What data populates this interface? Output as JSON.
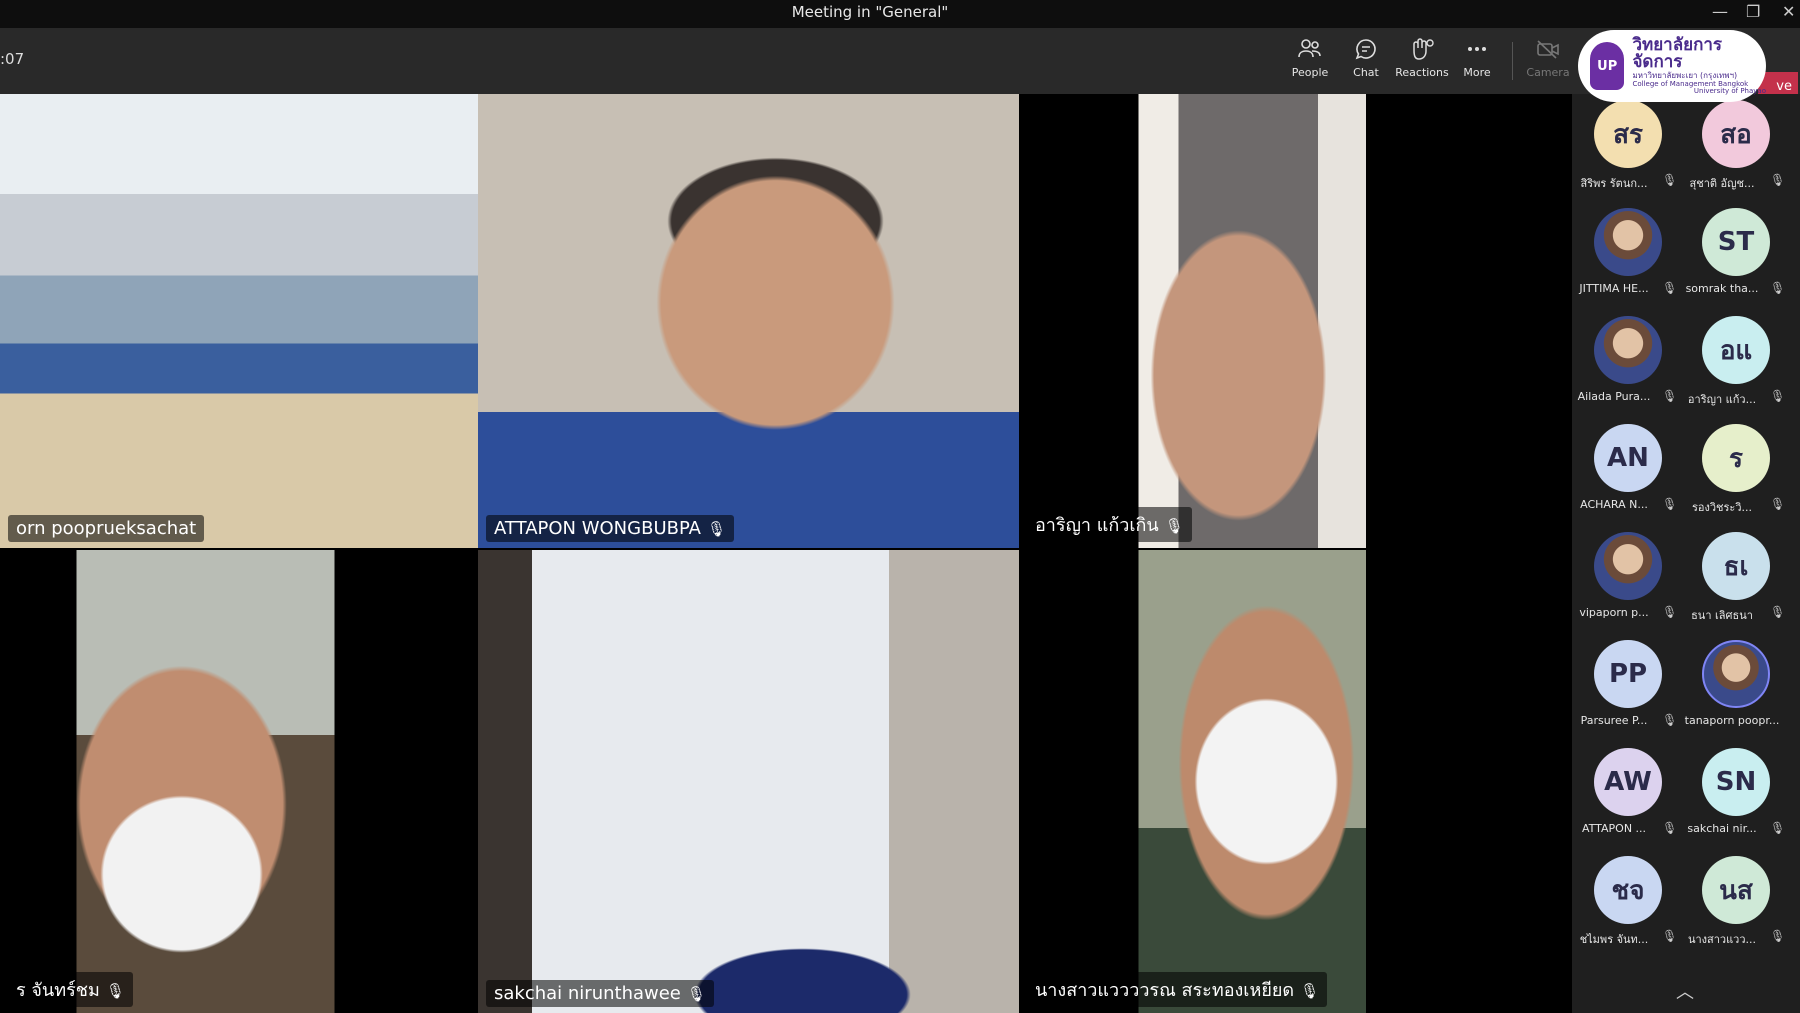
{
  "window": {
    "title": "Meeting in \"General\"",
    "minimize": "—",
    "restore": "❐",
    "close": "✕"
  },
  "toolbar": {
    "timer": ":07",
    "people": "People",
    "chat": "Chat",
    "reactions": "Reactions",
    "more": "More",
    "camera": "Camera",
    "leave": "ve"
  },
  "logo": {
    "line1": "วิทยาลัยการจัดการ",
    "line2": "มหาวิทยาลัยพะเยา (กรุงเทพฯ)",
    "line3": "College of Management Bangkok",
    "line4": "University of Phayao"
  },
  "tiles": [
    {
      "name": "orn pooprueksachat",
      "mic": false
    },
    {
      "name": "ATTAPON WONGBUBPA",
      "mic": true
    },
    {
      "name": "อาริญา แก้วเกิน",
      "mic": true
    },
    {
      "name": "ร จันทร์ชม",
      "mic": true
    },
    {
      "name": "sakchai nirunthawee",
      "mic": true
    },
    {
      "name": "นางสาวแววววรณ สระทองเหยียด",
      "mic": true
    }
  ],
  "participants": [
    {
      "initials": "สร",
      "name": "สิริพร รัตนก...",
      "color": "#f3dfb0"
    },
    {
      "initials": "สอ",
      "name": "สุชาติ อัญช...",
      "color": "#f2c9dc"
    },
    {
      "initials": "",
      "name": "JITTIMA HE...",
      "color": ""
    },
    {
      "initials": "ST",
      "name": "somrak tha...",
      "color": "#cfe9d7"
    },
    {
      "initials": "",
      "name": "Ailada Pura...",
      "color": ""
    },
    {
      "initials": "อแ",
      "name": "อาริญา แก้ว...",
      "color": "#c9eef0"
    },
    {
      "initials": "AN",
      "name": "ACHARA N...",
      "color": "#c9d7f2"
    },
    {
      "initials": "ร",
      "name": "รองวิชระวิ...",
      "color": "#e6efcb"
    },
    {
      "initials": "",
      "name": "vipaporn p...",
      "color": ""
    },
    {
      "initials": "ธเ",
      "name": "ธนา เลิศธนา",
      "color": "#c9e0ec"
    },
    {
      "initials": "PP",
      "name": "Parsuree P...",
      "color": "#c9d7f2"
    },
    {
      "initials": "",
      "name": "tanaporn poopr...",
      "color": ""
    },
    {
      "initials": "AW",
      "name": "ATTAPON ...",
      "color": "#dcd2ee"
    },
    {
      "initials": "SN",
      "name": "sakchai nir...",
      "color": "#c9eef0"
    },
    {
      "initials": "ชจ",
      "name": "ชไมพร จันท...",
      "color": "#c9d7f2"
    },
    {
      "initials": "นส",
      "name": "นางสาวแวว...",
      "color": "#cfe9d7"
    }
  ]
}
